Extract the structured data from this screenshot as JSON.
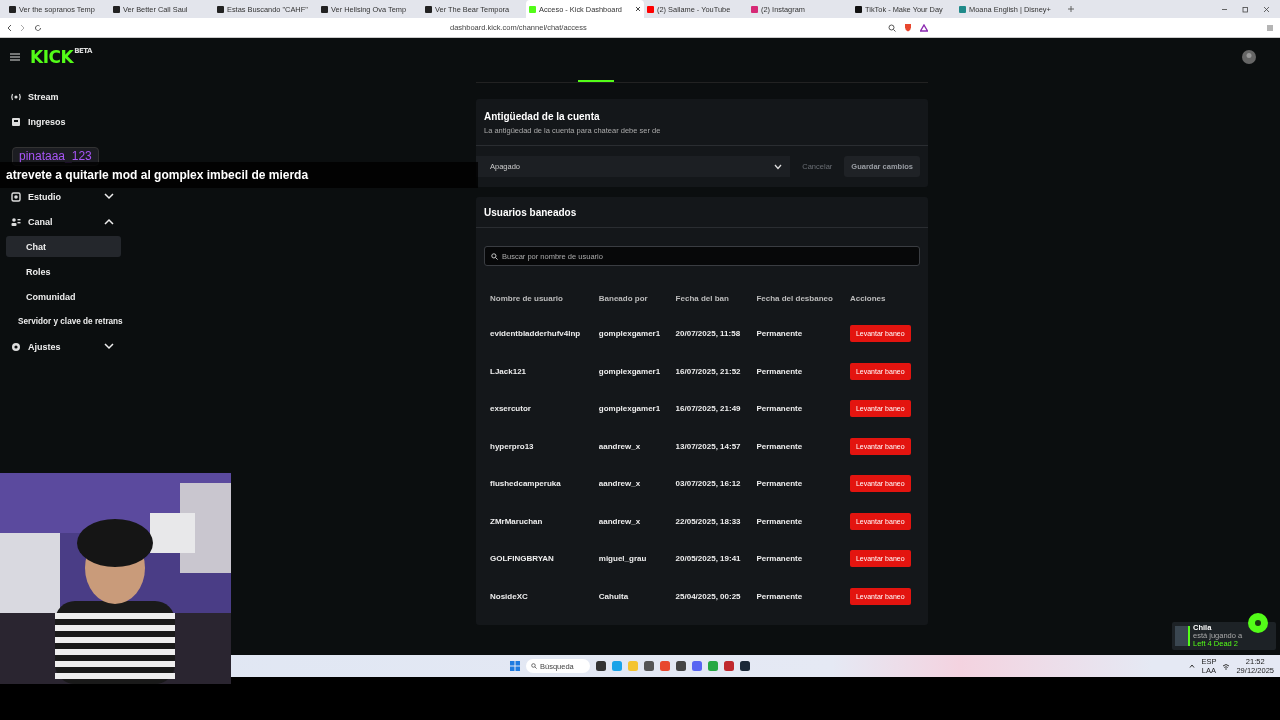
{
  "browser": {
    "tabs": [
      {
        "title": "Ver the sopranos Temp",
        "color": "#222222",
        "selected": false
      },
      {
        "title": "Ver Better Call Saul",
        "color": "#222222",
        "selected": false
      },
      {
        "title": "Estas Buscando \"CAHF\"",
        "color": "#222222",
        "selected": false
      },
      {
        "title": "Ver Hellsing Ova Temp",
        "color": "#222222",
        "selected": false
      },
      {
        "title": "Ver The Bear Tempora",
        "color": "#222222",
        "selected": false
      },
      {
        "title": "Acceso - Kick Dashboard",
        "color": "#53fc18",
        "selected": true
      },
      {
        "title": "(2) Sallame - YouTube",
        "color": "#ff0000",
        "selected": false
      },
      {
        "title": "(2) Instagram",
        "color": "#d62976",
        "selected": false
      },
      {
        "title": "TikTok - Make Your Day",
        "color": "#111111",
        "selected": false
      },
      {
        "title": "Moana English | Disney+",
        "color": "#1f8a8a",
        "selected": false
      }
    ],
    "url": "dashboard.kick.com/channel/chat/access"
  },
  "header": {
    "logo": "KICK",
    "logo_tag": "BETA"
  },
  "sidebar": {
    "items": [
      {
        "kind": "item",
        "label": "Stream"
      },
      {
        "kind": "item",
        "label": "Ingresos"
      },
      {
        "kind": "covered"
      },
      {
        "kind": "covered"
      },
      {
        "kind": "group",
        "label": "Estudio",
        "expanded": false
      },
      {
        "kind": "group",
        "label": "Canal",
        "expanded": true
      },
      {
        "kind": "subitem",
        "label": "Chat",
        "selected": true
      },
      {
        "kind": "subitem",
        "label": "Roles",
        "selected": false
      },
      {
        "kind": "subitem",
        "label": "Comunidad",
        "selected": false
      },
      {
        "kind": "link",
        "label": "Servidor y clave de retrans"
      },
      {
        "kind": "group",
        "label": "Ajustes",
        "expanded": false
      }
    ]
  },
  "account_age": {
    "title": "Antigüedad de la cuenta",
    "subtitle": "La antigüedad de la cuenta para chatear debe ser de",
    "select_value": "Apagado",
    "cancel_button": "Cancelar",
    "save_button": "Guardar cambios"
  },
  "banned_users": {
    "title": "Usuarios baneados",
    "search": {
      "placeholder": "Buscar por nombre de usuario"
    },
    "columns": [
      "Nombre de usuario",
      "Baneado por",
      "Fecha del ban",
      "Fecha del desbaneo",
      "Acciones"
    ],
    "rows": [
      {
        "user": "evidentbladderhufv4lnp",
        "banned_by": "gomplexgamer1",
        "date": "20/07/2025, 11:58",
        "unban": "Permanente",
        "action": "Levantar baneo"
      },
      {
        "user": "LJack121",
        "banned_by": "gomplexgamer1",
        "date": "16/07/2025, 21:52",
        "unban": "Permanente",
        "action": "Levantar baneo"
      },
      {
        "user": "exsercutor",
        "banned_by": "gomplexgamer1",
        "date": "16/07/2025, 21:49",
        "unban": "Permanente",
        "action": "Levantar baneo"
      },
      {
        "user": "hyperpro13",
        "banned_by": "aandrew_x",
        "date": "13/07/2025, 14:57",
        "unban": "Permanente",
        "action": "Levantar baneo"
      },
      {
        "user": "flushedcamperuka",
        "banned_by": "aandrew_x",
        "date": "03/07/2025, 16:12",
        "unban": "Permanente",
        "action": "Levantar baneo"
      },
      {
        "user": "ZMrMaruchan",
        "banned_by": "aandrew_x",
        "date": "22/05/2025, 18:33",
        "unban": "Permanente",
        "action": "Levantar baneo"
      },
      {
        "user": "GOLFINGBRYAN",
        "banned_by": "miguel_grau",
        "date": "20/05/2025, 19:41",
        "unban": "Permanente",
        "action": "Levantar baneo"
      },
      {
        "user": "NosideXC",
        "banned_by": "Cahulta",
        "date": "25/04/2025, 00:25",
        "unban": "Permanente",
        "action": "Levantar baneo"
      }
    ]
  },
  "stream_overlay": {
    "chat_user": "pinataaa_123",
    "chat_message": "atrevete a quitarle mod al gomplex imbecil de mierda"
  },
  "notification": {
    "name": "Chila",
    "status": "está jugando a",
    "game": "Left 4 Dead 2"
  },
  "taskbar": {
    "search_placeholder": "Búsqueda",
    "language": "ESP",
    "layout": "LAA",
    "time": "21:52",
    "date": "29/12/2025"
  }
}
